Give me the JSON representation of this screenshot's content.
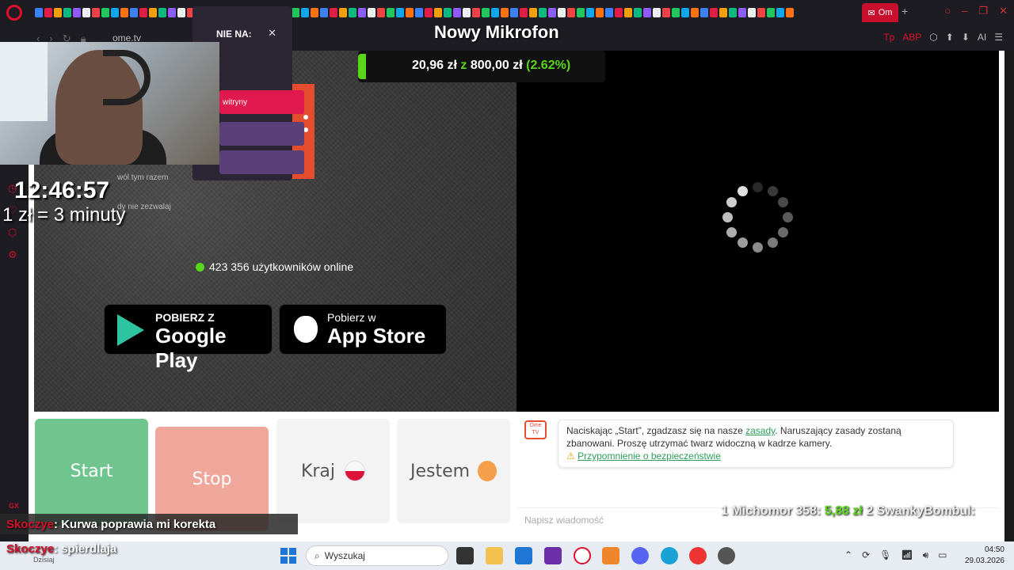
{
  "browser": {
    "url": "ome.tv",
    "active_tab_label": "Om",
    "addr_icons": [
      "Tp",
      "ABP",
      "⬡",
      "⬆",
      "⬇",
      "AI",
      "☰"
    ],
    "gx_label": "GX"
  },
  "stream_overlay": {
    "goal_title": "Nowy Mikrofon",
    "goal_current": "20,96 zł",
    "goal_separator": "z",
    "goal_target": "800,00 zł",
    "goal_percent": "(2.62%)",
    "goal_fraction": 0.0262,
    "clock": "12:46:57",
    "rate": "1 zł = 3 minuty"
  },
  "permission_popup": {
    "title": "NIE NA:",
    "allow_label": "witryny",
    "once_label": "wól tym razem",
    "never_label": "dy nie zezwalaj"
  },
  "ometv": {
    "online_text": "423 356 użytkowników online",
    "google_play": {
      "small": "POBIERZ Z",
      "big": "Google Play"
    },
    "app_store": {
      "small": "Pobierz w",
      "big": "App Store"
    }
  },
  "controls": {
    "start": "Start",
    "stop": "Stop",
    "country": "Kraj",
    "gender": "Jestem"
  },
  "chat": {
    "logo_text": "Ome TV",
    "notice_part1": "Naciskając „Start”, zgadzasz się na nasze ",
    "notice_link": "zasady",
    "notice_part2": ". Naruszający zasady zostaną zbanowani. Proszę utrzymać twarz widoczną w kadrze kamery.",
    "warn_icon": "⚠",
    "safety_link": "Przypomnienie o bezpieczeństwie",
    "input_placeholder": "Napisz wiadomość"
  },
  "stream_chat": [
    {
      "user": "Skoczye",
      "message": ": Kurwa poprawia mi korekta"
    },
    {
      "user": "Skoczye",
      "message": ": spierdlaja"
    }
  ],
  "donors": {
    "text1": "1 Michomor 358:",
    "amount1": "5,88 zł",
    "text2": "2 SwankyBombul:"
  },
  "taskbar": {
    "search_placeholder": "Wyszukaj",
    "today_label": "Dzisiaj",
    "time": "04:50",
    "date": "29.03.2026"
  },
  "colors": {
    "accent_red": "#c8102e",
    "start_green": "#6fc58d",
    "stop_salmon": "#efa79b",
    "goal_green": "#5ad61a"
  }
}
